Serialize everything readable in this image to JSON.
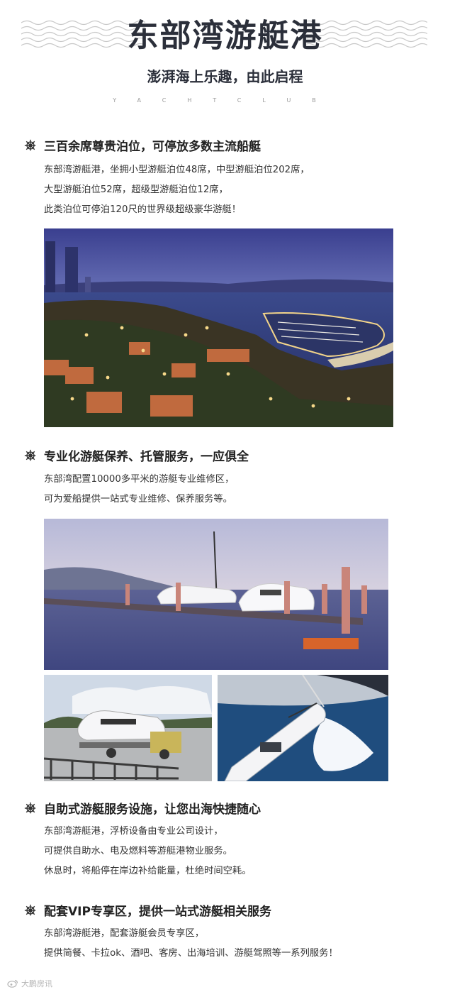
{
  "header": {
    "title": "东部湾游艇港",
    "subtitle": "澎湃海上乐趣，由此启程",
    "tagline": "YACHTCLUB"
  },
  "sections": [
    {
      "title": "三百余席尊贵泊位，可停放多数主流船艇",
      "lines": [
        "东部湾游艇港，坐拥小型游艇泊位48席，中型游艇泊位202席，",
        "大型游艇泊位52席，超级型游艇泊位12席，",
        "此类泊位可停泊120尺的世界级超级豪华游艇！"
      ]
    },
    {
      "title": "专业化游艇保养、托管服务，一应俱全",
      "lines": [
        "东部湾配置10000多平米的游艇专业维修区，",
        "可为爱船提供一站式专业维修、保养服务等。"
      ]
    },
    {
      "title": "自助式游艇服务设施，让您出海快捷随心",
      "lines": [
        "东部湾游艇港，浮桥设备由专业公司设计，",
        "可提供自助水、电及燃料等游艇港物业服务。",
        "休息时，将船停在岸边补给能量，杜绝时间空耗。"
      ]
    },
    {
      "title": "配套VIP专享区，提供一站式游艇相关服务",
      "lines": [
        "东部湾游艇港，配套游艇会员专享区，",
        "提供简餐、卡拉ok、酒吧、客房、出海培训、游艇驾照等一系列服务！"
      ]
    }
  ],
  "watermark": "大鹏房讯",
  "icons": {
    "section": "ship-wheel-icon",
    "watermark": "weibo-icon"
  },
  "colors": {
    "title": "#2b2f3a",
    "text": "#333333",
    "wave": "#c8c8c8"
  }
}
